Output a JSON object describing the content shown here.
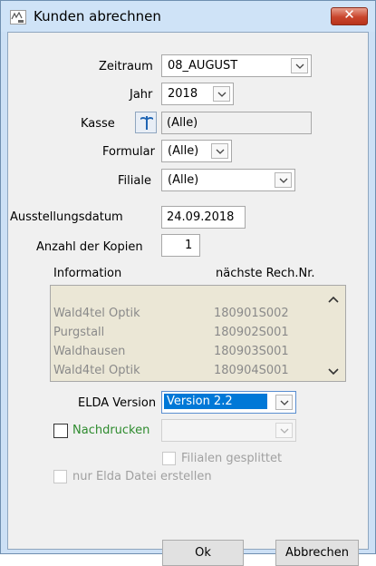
{
  "window": {
    "title": "Kunden abrechnen",
    "close_icon": "close-x-icon"
  },
  "form": {
    "zeitraum_label": "Zeitraum",
    "zeitraum_value": "08_AUGUST",
    "jahr_label": "Jahr",
    "jahr_value": "2018",
    "kasse_label": "Kasse",
    "kasse_value": "(Alle)",
    "formular_label": "Formular",
    "formular_value": "(Alle)",
    "filiale_label": "Filiale",
    "filiale_value": "(Alle)",
    "ausstellungsdatum_label": "Ausstellungsdatum",
    "ausstellungsdatum_value": "24.09.2018",
    "kopien_label": "Anzahl der Kopien",
    "kopien_value": "1"
  },
  "table": {
    "col1": "Information",
    "col2": "nächste Rech.Nr.",
    "rows": [
      {
        "info": "Wald4tel Optik",
        "nr": "180901S002"
      },
      {
        "info": "Purgstall",
        "nr": "180902S001"
      },
      {
        "info": "Waldhausen",
        "nr": "180903S001"
      },
      {
        "info": "Wald4tel Optik",
        "nr": "180904S001"
      }
    ]
  },
  "elda": {
    "label": "ELDA Version",
    "value": "Version 2.2"
  },
  "nachdrucken": {
    "label": "Nachdrucken",
    "value": ""
  },
  "filialen_gesplittet": "Filialen gesplittet",
  "nur_elda": "nur Elda Datei erstellen",
  "buttons": {
    "ok": "Ok",
    "abbrechen": "Abbrechen"
  },
  "colors": {
    "title_bg": "#cfe3f7",
    "close_red": "#c9452c",
    "selection_blue": "#0078d7",
    "nachdrucken_green": "#2e8b2e",
    "list_bg": "#ebe7d6"
  }
}
